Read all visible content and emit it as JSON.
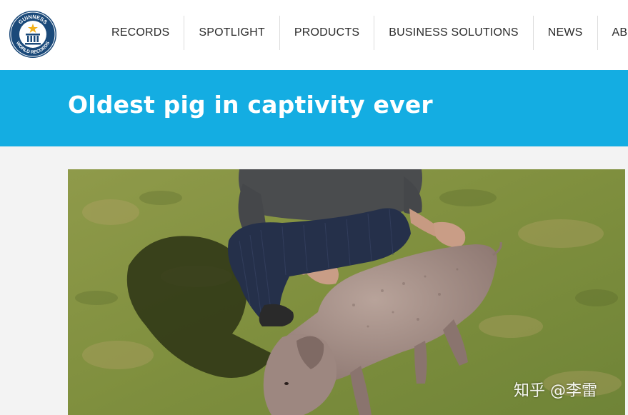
{
  "header": {
    "logo": {
      "text_top": "GUINNESS",
      "text_bottom": "WORLD RECORDS",
      "icon": "gwr-logo"
    },
    "nav": [
      {
        "label": "RECORDS"
      },
      {
        "label": "SPOTLIGHT"
      },
      {
        "label": "PRODUCTS"
      },
      {
        "label": "BUSINESS SOLUTIONS"
      },
      {
        "label": "NEWS"
      },
      {
        "label": "ABOU"
      }
    ]
  },
  "banner": {
    "title": "Oldest pig in captivity ever"
  },
  "photo": {
    "subject": "photo-person-kneeling-with-pig-on-grass"
  },
  "watermark": {
    "text": "知乎 @李雷"
  },
  "colors": {
    "banner": "#14ade2",
    "logo_ring": "#1b4a7a",
    "page_bg": "#f3f3f3"
  }
}
